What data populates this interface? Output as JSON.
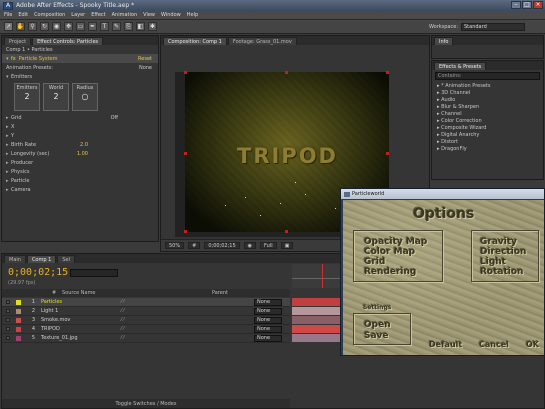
{
  "app": {
    "title": "Adobe After Effects - Spooky Title.aep *",
    "menus": [
      "File",
      "Edit",
      "Composition",
      "Layer",
      "Effect",
      "Animation",
      "View",
      "Window",
      "Help"
    ]
  },
  "toolbar": {
    "workspace_label": "Workspace:",
    "workspace_value": "Standard"
  },
  "project_panel": {
    "tabs": [
      "Project",
      "Effect Controls: Particles"
    ],
    "breadcrumb": "Comp 1 • Particles",
    "effect_name": "Particle System",
    "effect_reset": "Reset",
    "animation_presets_label": "Animation Presets:",
    "animation_presets_value": "None",
    "sections": [
      "Emitters"
    ],
    "emitter_cols": [
      {
        "label": "Emitters",
        "value": "2"
      },
      {
        "label": "World",
        "value": "2"
      },
      {
        "label": "Radius",
        "value": ""
      }
    ],
    "rows": [
      {
        "label": "Grid",
        "value": "Off"
      },
      {
        "label": "X",
        "value": ""
      },
      {
        "label": "Y",
        "value": ""
      },
      {
        "label": "Birth Rate",
        "value": "2.0"
      },
      {
        "label": "Longevity (sec)",
        "value": "1.00"
      },
      {
        "label": "Producer",
        "value": ""
      },
      {
        "label": "Physics",
        "value": ""
      },
      {
        "label": "Particle",
        "value": ""
      },
      {
        "label": "Camera",
        "value": ""
      }
    ]
  },
  "comp_panel": {
    "tabs": [
      "Composition: Comp 1",
      "Footage: Grass_01.mov"
    ],
    "title_text": "TRIPOD",
    "zoom": "50%",
    "timecode": "0;00;02;15",
    "resolution": "Full"
  },
  "info_panel": {
    "tabs": [
      "Info"
    ]
  },
  "effects_panel": {
    "tabs": [
      "Effects & Presets"
    ],
    "search_placeholder": "Contains:",
    "items": [
      "* Animation Presets",
      "3D Channel",
      "Audio",
      "Blur & Sharpen",
      "Channel",
      "Color Correction",
      "Composite Wizard",
      "Digital Anarchy",
      "Distort",
      "DragonFly"
    ]
  },
  "timeline": {
    "tabs": [
      "Main",
      "Comp 1",
      "Sel"
    ],
    "timecode": "0;00;02;15",
    "fps": "(29.97 fps)",
    "columns": [
      "#",
      "Source Name",
      "Parent"
    ],
    "layers": [
      {
        "num": "1",
        "name": "Particles",
        "parent": "None",
        "color": "#e0e020",
        "bar": "#c04040"
      },
      {
        "num": "2",
        "name": "Light 1",
        "parent": "None",
        "color": "#b08878",
        "bar": "#b5969a"
      },
      {
        "num": "3",
        "name": "Smoke.mov",
        "parent": "None",
        "color": "#c85050",
        "bar": "#8a6068"
      },
      {
        "num": "4",
        "name": "TRIPOD",
        "parent": "None",
        "color": "#d04040",
        "bar": "#d04848"
      },
      {
        "num": "5",
        "name": "Texture_01.jpg",
        "parent": "None",
        "color": "#a04070",
        "bar": "#987888"
      }
    ],
    "toggle_label": "Toggle Switches / Modes"
  },
  "dialog": {
    "title": "Particleworld",
    "heading": "Options",
    "left_options": [
      "Opacity Map",
      "Color Map",
      "Grid",
      "Rendering"
    ],
    "right_options": [
      "Gravity",
      "Direction",
      "Light",
      "Rotation"
    ],
    "settings_label": "Settings",
    "settings_options": [
      "Open",
      "Save"
    ],
    "buttons": [
      "Default",
      "Cancel",
      "OK"
    ]
  },
  "colors": {
    "timecode": "#e8b020",
    "accent_label": "#e0e020"
  }
}
